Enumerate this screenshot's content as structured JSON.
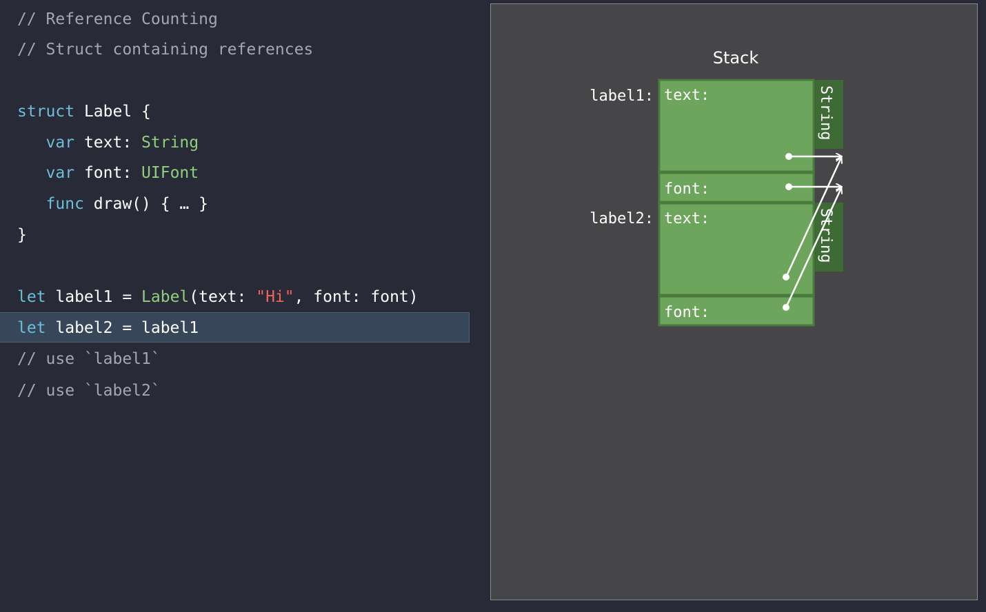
{
  "code": {
    "lines": [
      {
        "tokens": [
          {
            "t": "// Reference Counting",
            "k": "comment"
          }
        ]
      },
      {
        "tokens": [
          {
            "t": "// Struct containing references",
            "k": "comment"
          }
        ]
      },
      {
        "tokens": []
      },
      {
        "tokens": [
          {
            "t": "struct",
            "k": "keyword"
          },
          {
            "t": " Label {",
            "k": "plain"
          }
        ]
      },
      {
        "tokens": [
          {
            "t": "   ",
            "k": "plain"
          },
          {
            "t": "var",
            "k": "keyword"
          },
          {
            "t": " text: ",
            "k": "plain"
          },
          {
            "t": "String",
            "k": "type"
          }
        ]
      },
      {
        "tokens": [
          {
            "t": "   ",
            "k": "plain"
          },
          {
            "t": "var",
            "k": "keyword"
          },
          {
            "t": " font: ",
            "k": "plain"
          },
          {
            "t": "UIFont",
            "k": "type"
          }
        ]
      },
      {
        "tokens": [
          {
            "t": "   ",
            "k": "plain"
          },
          {
            "t": "func",
            "k": "keyword"
          },
          {
            "t": " draw() { … }",
            "k": "plain"
          }
        ]
      },
      {
        "tokens": [
          {
            "t": "}",
            "k": "plain"
          }
        ]
      },
      {
        "tokens": []
      },
      {
        "tokens": [
          {
            "t": "let",
            "k": "keyword"
          },
          {
            "t": " label1 = ",
            "k": "plain"
          },
          {
            "t": "Label",
            "k": "type"
          },
          {
            "t": "(text: ",
            "k": "plain"
          },
          {
            "t": "\"Hi\"",
            "k": "string"
          },
          {
            "t": ", font: font)",
            "k": "plain"
          }
        ]
      },
      {
        "tokens": [
          {
            "t": "let",
            "k": "keyword"
          },
          {
            "t": " label2 = label1",
            "k": "plain"
          }
        ],
        "highlighted": true
      },
      {
        "tokens": [
          {
            "t": "// use `label1`",
            "k": "comment"
          }
        ]
      },
      {
        "tokens": [
          {
            "t": "// use `label2`",
            "k": "comment"
          }
        ]
      }
    ]
  },
  "diagram": {
    "title": "Stack",
    "label1": "label1:",
    "label2": "label2:",
    "field_text": "text:",
    "field_font": "font:",
    "string_label": "String"
  },
  "colors": {
    "background": "#292a37",
    "panel": "#464648",
    "green_cell": "#6da55c",
    "green_border": "#4a7a3e",
    "string_strip": "#3e6a36",
    "comment": "#a3a7b0",
    "keyword": "#6bbfd8",
    "type": "#8ed07c",
    "string": "#f2645a",
    "highlight": "#384659"
  }
}
